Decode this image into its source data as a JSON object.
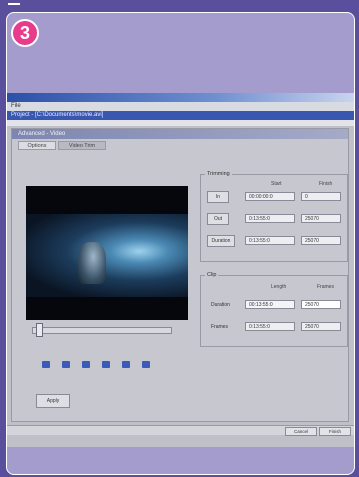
{
  "step_number": "3",
  "app": {
    "menu_label": "File",
    "document_title": "Project - [C:\\Documents\\movie.avi]",
    "panel_title": "Advanced - Video",
    "tabs": [
      {
        "label": "Options"
      },
      {
        "label": "Video Trim"
      }
    ]
  },
  "settings": {
    "group1_label": "Trimming",
    "col_start": "Start",
    "col_end": "Finish",
    "rows": [
      {
        "button": "In",
        "start": "00:00:00:0",
        "end": "0"
      },
      {
        "button": "Out",
        "start": "0:13:55:0",
        "end": "25070"
      },
      {
        "button": "Duration",
        "start": "0:13:55:0",
        "end": "25070"
      }
    ],
    "group2_label": "Clip",
    "col2_start": "Length",
    "col2_end": "Frames",
    "rows2": [
      {
        "label": "Duration",
        "start": "00:13:55:0",
        "end": "25070"
      },
      {
        "label": "Frames",
        "start": "0:13:55:0",
        "end": "25070"
      }
    ]
  },
  "ok_label": "Apply",
  "status_buttons": [
    "Cancel",
    "Finish"
  ]
}
